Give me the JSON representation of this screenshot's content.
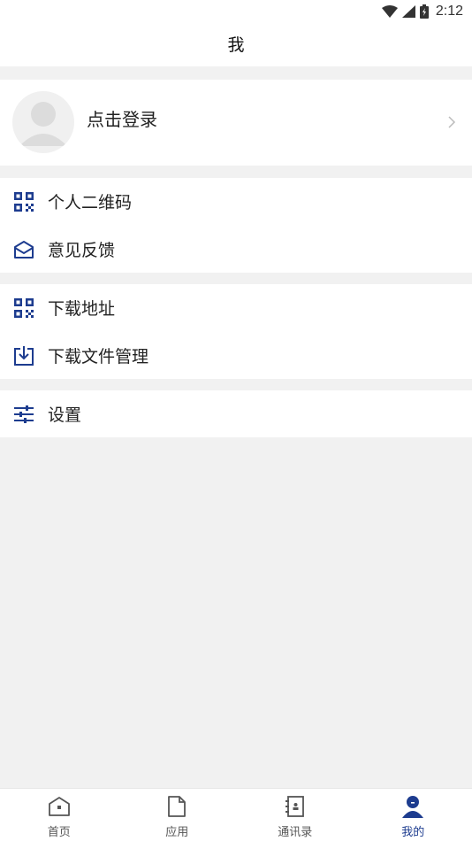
{
  "status_bar": {
    "time": "2:12",
    "icons": [
      "wifi-icon",
      "signal-icon",
      "battery-icon"
    ]
  },
  "header": {
    "title": "我"
  },
  "profile": {
    "login_label": "点击登录"
  },
  "menu_groups": [
    [
      {
        "label": "个人二维码",
        "icon": "qr-code-icon"
      },
      {
        "label": "意见反馈",
        "icon": "envelope-icon"
      }
    ],
    [
      {
        "label": "下载地址",
        "icon": "qr-code-icon"
      },
      {
        "label": "下载文件管理",
        "icon": "download-icon"
      }
    ],
    [
      {
        "label": "设置",
        "icon": "sliders-icon"
      }
    ]
  ],
  "tabs": [
    {
      "label": "首页",
      "icon": "home-icon",
      "active": false
    },
    {
      "label": "应用",
      "icon": "file-icon",
      "active": false
    },
    {
      "label": "通讯录",
      "icon": "contacts-icon",
      "active": false
    },
    {
      "label": "我的",
      "icon": "person-icon",
      "active": true
    }
  ],
  "colors": {
    "accent": "#1d3c8f",
    "background": "#f1f1f1",
    "surface": "#ffffff",
    "inactive": "#555555"
  }
}
